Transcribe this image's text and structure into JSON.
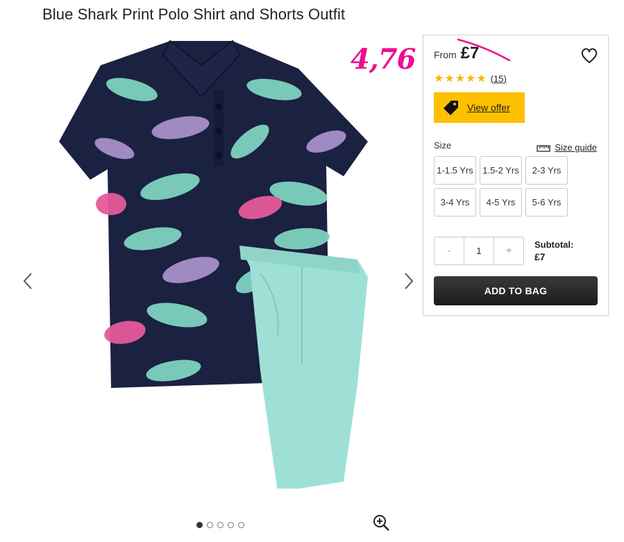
{
  "product": {
    "title": "Blue Shark Print Polo Shirt and Shorts Outfit"
  },
  "annotation": {
    "handwritten_price": "4,76",
    "color": "#ee0f8e"
  },
  "panel": {
    "from_label": "From",
    "price": "£7",
    "rating": {
      "stars": 5,
      "count_label": "(15)",
      "star_color": "#f5b800"
    },
    "offer_button": {
      "label": "View offer",
      "icon": "price-tag-icon",
      "color": "#ffc000"
    },
    "size": {
      "label": "Size",
      "guide_label": "Size guide",
      "options": [
        "1-1.5 Yrs",
        "1.5-2 Yrs",
        "2-3 Yrs",
        "3-4 Yrs",
        "4-5 Yrs",
        "5-6 Yrs"
      ]
    },
    "quantity": {
      "minus": "-",
      "value": "1",
      "plus": "+"
    },
    "subtotal": {
      "label": "Subtotal:",
      "value": "£7"
    },
    "add_to_bag": "ADD TO BAG"
  },
  "gallery": {
    "dots": 5,
    "active_index": 0,
    "icons": [
      "chevron-left-icon",
      "chevron-right-icon",
      "zoom-in-icon"
    ]
  }
}
